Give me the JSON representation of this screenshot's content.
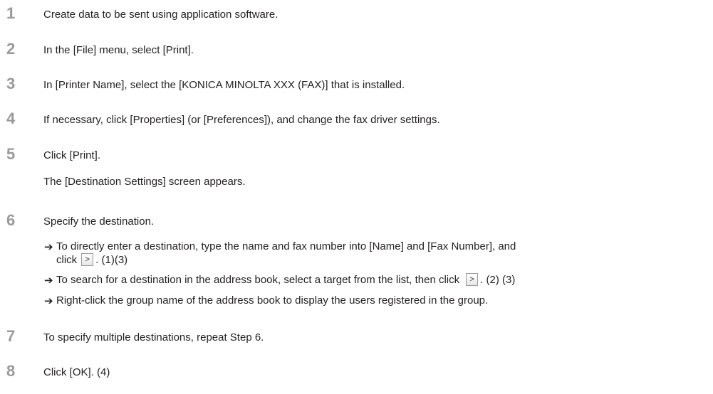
{
  "steps": [
    {
      "number": "1",
      "text": "Create data to be sent using application software."
    },
    {
      "number": "2",
      "text": "In the [File] menu, select [Print]."
    },
    {
      "number": "3",
      "text": "In [Printer Name], select the [KONICA MINOLTA XXX (FAX)] that is installed."
    },
    {
      "number": "4",
      "text": "If necessary, click [Properties] (or [Preferences]), and change the fax driver settings."
    },
    {
      "number": "5",
      "text": "Click [Print].",
      "note": "The [Destination Settings] screen appears."
    },
    {
      "number": "6",
      "text": "Specify the destination."
    },
    {
      "number": "7",
      "text": "To specify multiple destinations, repeat Step 6."
    },
    {
      "number": "8",
      "text": "Click [OK]. (4)"
    }
  ],
  "bullets": {
    "arrow": "➔",
    "b1_line1": "To directly enter a destination, type the name and fax number into [Name] and [Fax Number], and",
    "b1_line2_pre": "click",
    "b1_line2_post": ". (1)(3)",
    "b2_pre": "To search for a destination in the address book, select a target from the list, then click",
    "b2_post": ". (2) (3)",
    "b3": "Right-click the group name of the address book to display the users registered in the group.",
    "button_glyph": ">"
  }
}
